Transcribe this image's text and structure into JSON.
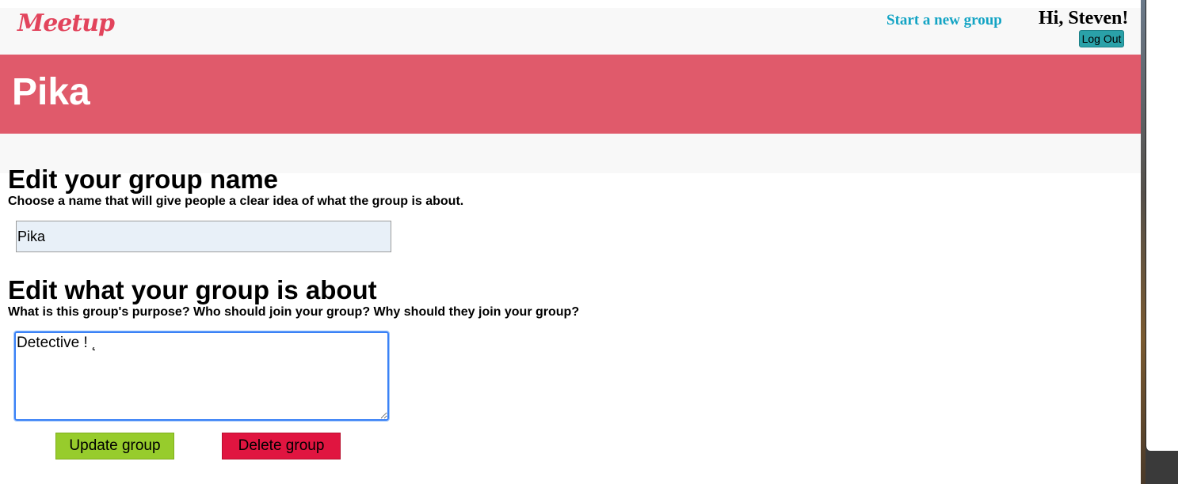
{
  "header": {
    "logo": "Meetup",
    "new_group_link": "Start a new group",
    "greeting": "Hi, Steven!",
    "logout_label": "Log Out"
  },
  "banner": {
    "title": "Pika"
  },
  "form": {
    "name_section": {
      "title": "Edit your group name",
      "subtitle": "Choose a name that will give people a clear idea of what the group is about.",
      "value": "Pika"
    },
    "about_section": {
      "title": "Edit what your group is about",
      "subtitle": "What is this group's purpose? Who should join your group? Why should they join your group?",
      "value": "Detective ! ˛"
    },
    "update_label": "Update group",
    "delete_label": "Delete group"
  },
  "colors": {
    "brand": "#e2445c",
    "banner": "#e05a6b",
    "link": "#13a4c4",
    "logout": "#2aa1a8",
    "update": "#97cc2c",
    "delete": "#e01540"
  }
}
